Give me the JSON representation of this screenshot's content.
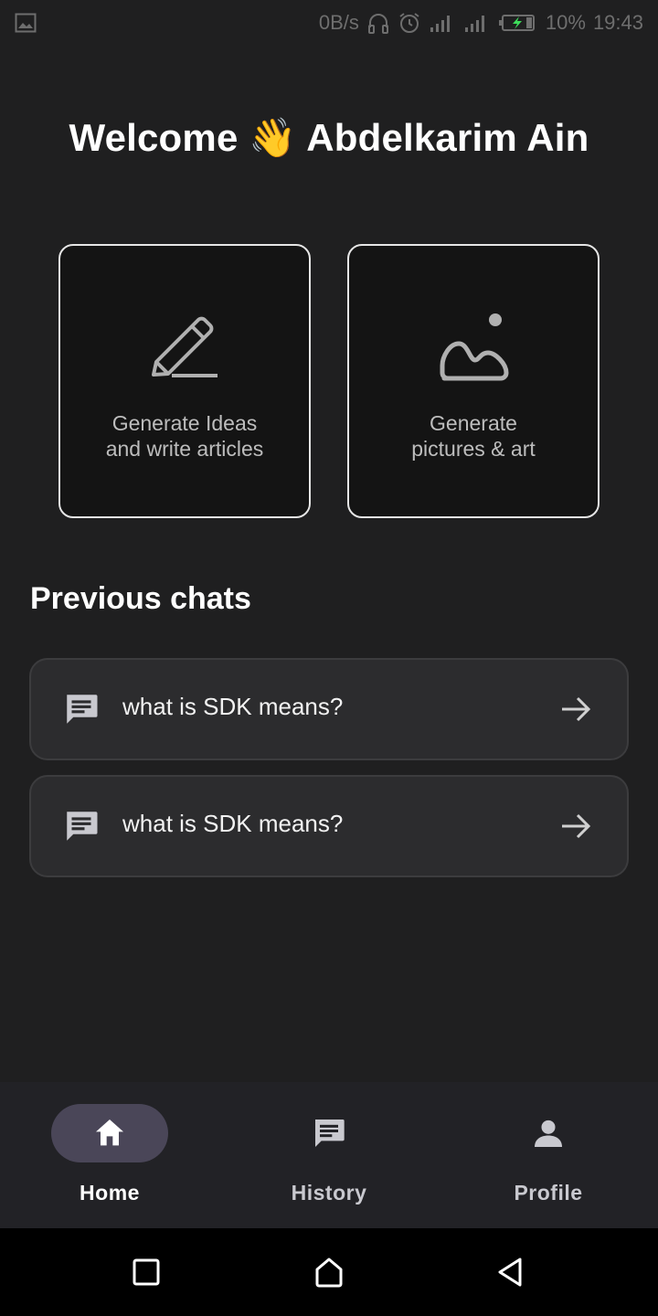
{
  "status_bar": {
    "net_speed": "0B/s",
    "battery": "10%",
    "time": "19:43",
    "icons": [
      "image-icon",
      "headphones-icon",
      "alarm-icon",
      "signal-icon",
      "signal-icon",
      "battery-charging-icon"
    ]
  },
  "welcome": {
    "prefix": "Welcome",
    "emoji": "👋",
    "name": "Abdelkarim Ain"
  },
  "cards": [
    {
      "icon": "pencil-icon",
      "line1": "Generate Ideas",
      "line2": "and write articles"
    },
    {
      "icon": "landscape-icon",
      "line1": "Generate",
      "line2": "pictures & art"
    }
  ],
  "previous_chats": {
    "title": "Previous chats",
    "items": [
      {
        "icon": "chat-icon",
        "text": "what is SDK means?"
      },
      {
        "icon": "chat-icon",
        "text": "what is SDK means?"
      }
    ]
  },
  "bottom_nav": {
    "items": [
      {
        "label": "Home",
        "icon": "home-icon",
        "active": true
      },
      {
        "label": "History",
        "icon": "chat-icon",
        "active": false
      },
      {
        "label": "Profile",
        "icon": "person-icon",
        "active": false
      }
    ]
  },
  "colors": {
    "background": "#1f1f20",
    "card_border": "#e6e6e6",
    "chat_item_bg": "#2c2c2e",
    "nav_pill": "#4a4658"
  }
}
